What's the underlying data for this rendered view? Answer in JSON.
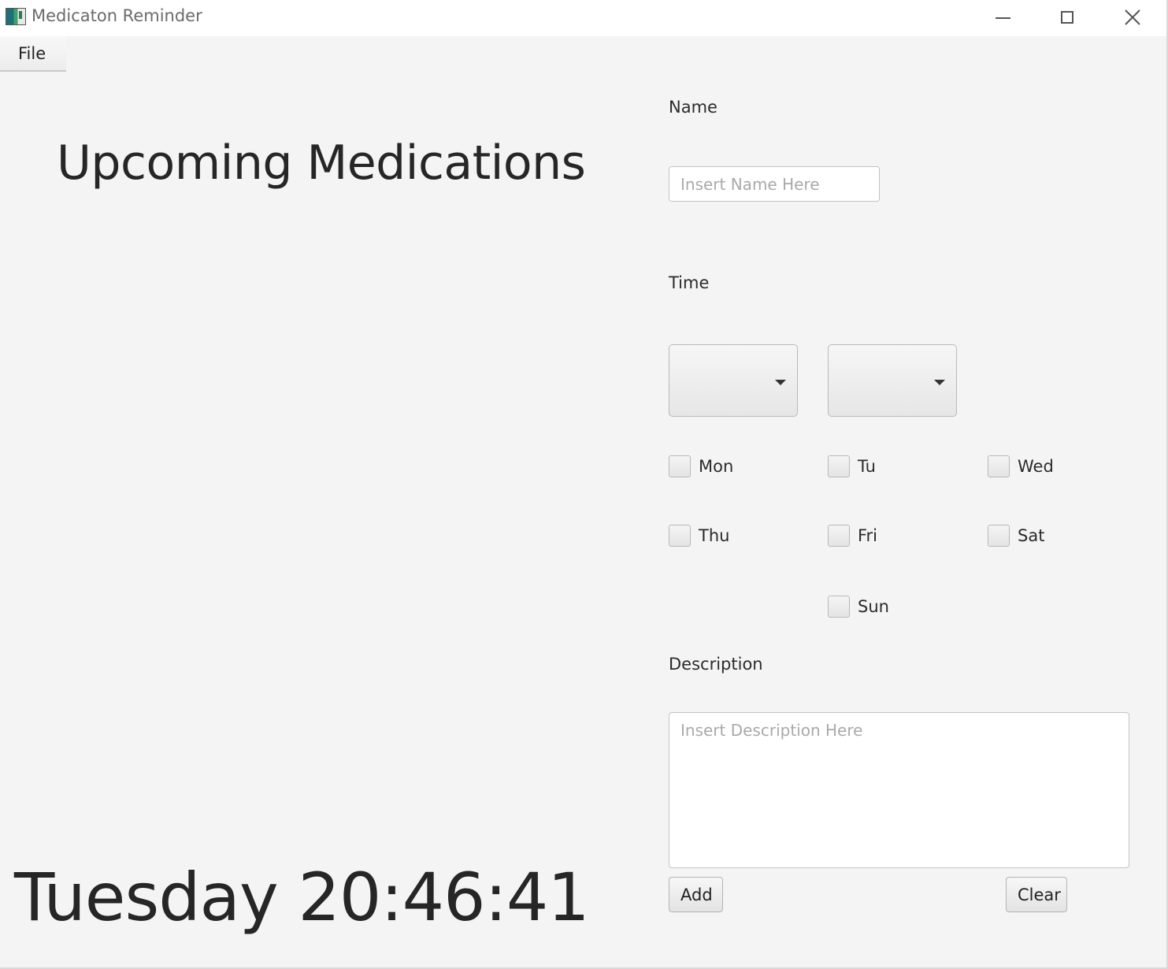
{
  "window": {
    "title": "Medicaton Reminder",
    "icons": {
      "app": "app-icon",
      "minimize": "minimize-icon",
      "maximize": "maximize-icon",
      "close": "close-icon"
    }
  },
  "menu": {
    "file_label": "File"
  },
  "main": {
    "heading": "Upcoming Medications",
    "clock": "Tuesday 20:46:41"
  },
  "form": {
    "name": {
      "label": "Name",
      "value": "",
      "placeholder": "Insert Name Here"
    },
    "time": {
      "label": "Time",
      "hour_value": "",
      "minute_value": ""
    },
    "days": [
      {
        "label": "Mon",
        "checked": false
      },
      {
        "label": "Tu",
        "checked": false
      },
      {
        "label": "Wed",
        "checked": false
      },
      {
        "label": "Thu",
        "checked": false
      },
      {
        "label": "Fri",
        "checked": false
      },
      {
        "label": "Sat",
        "checked": false
      },
      {
        "label": "Sun",
        "checked": false
      }
    ],
    "description": {
      "label": "Description",
      "value": "",
      "placeholder": "Insert Description Here"
    },
    "add_label": "Add",
    "clear_label": "Clear"
  }
}
